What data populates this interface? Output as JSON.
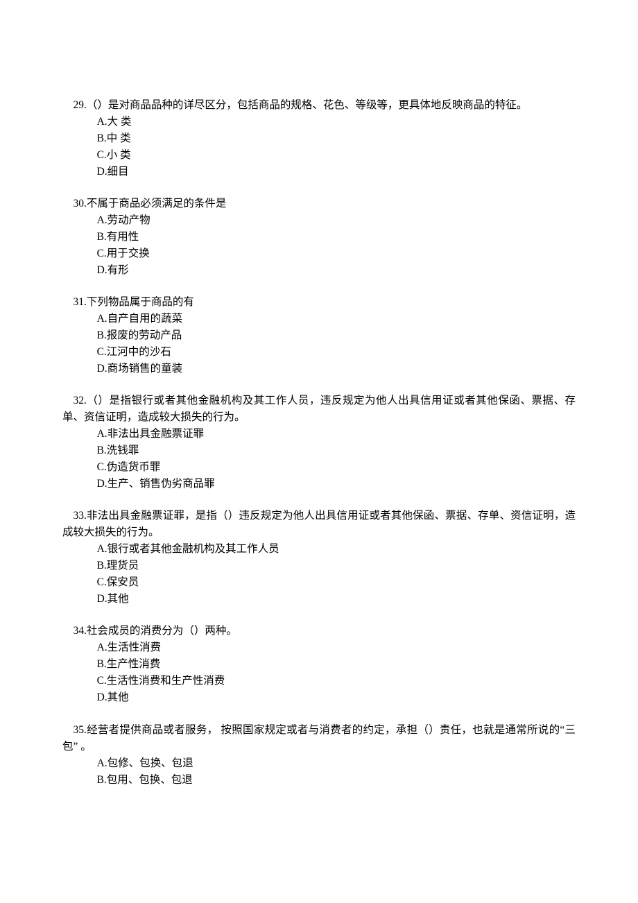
{
  "questions": [
    {
      "number": "29.",
      "stem": "（）是对商品品种的详尽区分，包括商品的规格、花色、等级等，更具体地反映商品的特征。",
      "options": [
        "A.大 类",
        "B.中 类",
        "C.小 类",
        "D.细目"
      ]
    },
    {
      "number": "30.",
      "stem": "不属于商品必须满足的条件是",
      "options": [
        "A.劳动产物",
        "B.有用性",
        "C.用于交换",
        "D.有形"
      ]
    },
    {
      "number": "31.",
      "stem": "下列物品属于商品的有",
      "options": [
        "A.自产自用的蔬菜",
        "B.报废的劳动产品",
        "C.江河中的沙石",
        "D.商场销售的童装"
      ]
    },
    {
      "number": "32.",
      "stem": "（）是指银行或者其他金融机构及其工作人员，违反规定为他人出具信用证或者其他保函、票据、存单、资信证明，造成较大损失的行为。",
      "options": [
        "A.非法出具金融票证罪",
        "B.洗钱罪",
        "C.伪造货币罪",
        "D.生产、销售伪劣商品罪"
      ]
    },
    {
      "number": "33.",
      "stem": "非法出具金融票证罪，是指（）违反规定为他人出具信用证或者其他保函、票据、存单、资信证明，造成较大损失的行为。",
      "options": [
        "A.银行或者其他金融机构及其工作人员",
        "B.理货员",
        "C.保安员",
        "D.其他"
      ]
    },
    {
      "number": "34.",
      "stem": "社会成员的消费分为（）两种。",
      "options": [
        "A.生活性消费",
        "B.生产性消费",
        "C.生活性消费和生产性消费",
        "D.其他"
      ]
    },
    {
      "number": "35.",
      "stem": "经营者提供商品或者服务， 按照国家规定或者与消费者的约定，承担（）责任，也就是通常所说的“三包” 。",
      "options": [
        "A.包修、包换、包退",
        "B.包用、包换、包退"
      ]
    }
  ]
}
